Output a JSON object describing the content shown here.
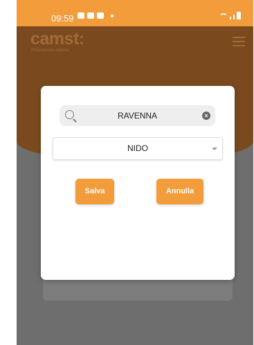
{
  "status_bar": {
    "time": "09:59"
  },
  "app_bar": {
    "logo": "camst:",
    "logo_subtitle": "Ristorazione Italiana"
  },
  "dialog": {
    "search": {
      "value": "RAVENNA"
    },
    "select": {
      "selected": "NIDO"
    },
    "buttons": {
      "save_label": "Salva",
      "cancel_label": "Annulla"
    }
  },
  "colors": {
    "accent": "#f39c3c",
    "brand_dark": "#7a4a1e",
    "scrim": "#6e6e6e"
  }
}
